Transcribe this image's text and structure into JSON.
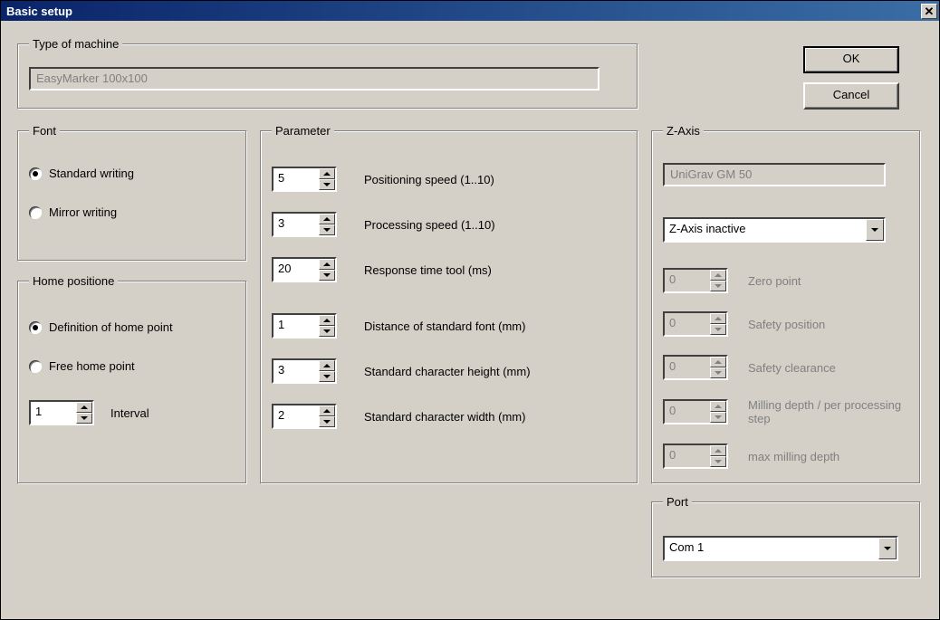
{
  "window": {
    "title": "Basic setup"
  },
  "actions": {
    "ok": "OK",
    "cancel": "Cancel"
  },
  "machine": {
    "legend": "Type of machine",
    "value": "EasyMarker  100x100"
  },
  "font": {
    "legend": "Font",
    "standard": "Standard writing",
    "mirror": "Mirror writing",
    "selected": "standard"
  },
  "home": {
    "legend": "Home positione",
    "definition": "Definition of home point",
    "free": "Free home point",
    "selected": "definition",
    "interval_value": "1",
    "interval_label": "Interval"
  },
  "param": {
    "legend": "Parameter",
    "positioning_speed": {
      "value": "5",
      "label": "Positioning speed (1..10)"
    },
    "processing_speed": {
      "value": "3",
      "label": "Processing speed (1..10)"
    },
    "response_time": {
      "value": "20",
      "label": "Response time tool (ms)"
    },
    "distance_font": {
      "value": "1",
      "label": "Distance of standard font (mm)"
    },
    "char_height": {
      "value": "3",
      "label": "Standard character height (mm)"
    },
    "char_width": {
      "value": "2",
      "label": "Standard character width (mm)"
    }
  },
  "zaxis": {
    "legend": "Z-Axis",
    "device": "UniGrav GM  50",
    "mode": "Z-Axis inactive",
    "zero_point": {
      "value": "0",
      "label": "Zero point"
    },
    "safety_position": {
      "value": "0",
      "label": "Safety position"
    },
    "safety_clearance": {
      "value": "0",
      "label": "Safety clearance"
    },
    "milling_depth": {
      "value": "0",
      "label": "Milling depth / per processing step"
    },
    "max_milling": {
      "value": "0",
      "label": "max milling depth"
    }
  },
  "port": {
    "legend": "Port",
    "value": "Com 1"
  }
}
